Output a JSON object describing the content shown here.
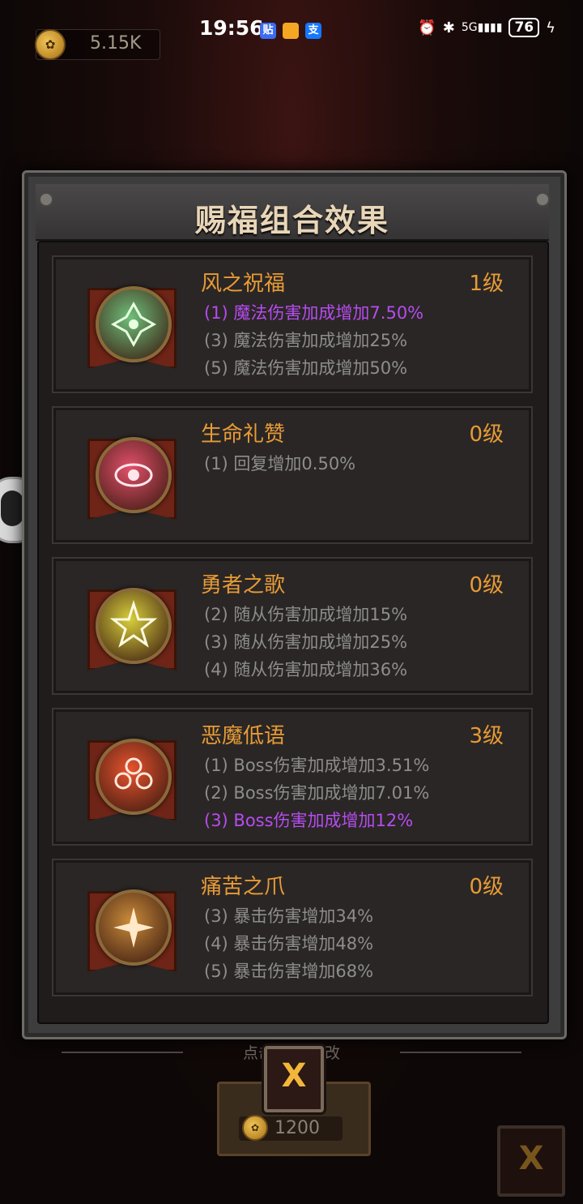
{
  "status_bar": {
    "time": "19:56",
    "app_badges": [
      "贴",
      "",
      "支"
    ],
    "battery": "76"
  },
  "top_currency": {
    "value": "5.15K",
    "icon": "paw-coin-icon"
  },
  "panel": {
    "title": "赐福组合效果",
    "cards": [
      {
        "name": "风之祝福",
        "level": "1级",
        "emblem_color": "#6fbf7a",
        "icon": "wind-blessing-icon",
        "effects": [
          {
            "text": "(1) 魔法伤害加成增加7.50%",
            "active": true
          },
          {
            "text": "(3) 魔法伤害加成增加25%",
            "active": false
          },
          {
            "text": "(5) 魔法伤害加成增加50%",
            "active": false
          }
        ]
      },
      {
        "name": "生命礼赞",
        "level": "0级",
        "emblem_color": "#e2506a",
        "icon": "life-eye-icon",
        "effects": [
          {
            "text": "(1) 回复增加0.50%",
            "active": false
          }
        ]
      },
      {
        "name": "勇者之歌",
        "level": "0级",
        "emblem_color": "#d8cf3c",
        "icon": "hero-star-icon",
        "effects": [
          {
            "text": "(2) 随从伤害加成增加15%",
            "active": false
          },
          {
            "text": "(3) 随从伤害加成增加25%",
            "active": false
          },
          {
            "text": "(4) 随从伤害加成增加36%",
            "active": false
          }
        ]
      },
      {
        "name": "恶魔低语",
        "level": "3级",
        "emblem_color": "#e8532e",
        "icon": "demon-flower-icon",
        "effects": [
          {
            "text": "(1) Boss伤害加成增加3.51%",
            "active": false
          },
          {
            "text": "(2) Boss伤害加成增加7.01%",
            "active": false
          },
          {
            "text": "(3) Boss伤害加成增加12%",
            "active": true
          }
        ]
      },
      {
        "name": "痛苦之爪",
        "level": "0级",
        "emblem_color": "#c98a3a",
        "icon": "pain-claw-icon",
        "effects": [
          {
            "text": "(3) 暴击伤害增加34%",
            "active": false
          },
          {
            "text": "(4) 暴击伤害增加48%",
            "active": false
          },
          {
            "text": "(5) 暴击伤害增加68%",
            "active": false
          }
        ]
      }
    ]
  },
  "bottom": {
    "hint": "点击栏      止更改",
    "close_label": "X",
    "buy_price": "1200",
    "secondary_close_label": "X"
  }
}
